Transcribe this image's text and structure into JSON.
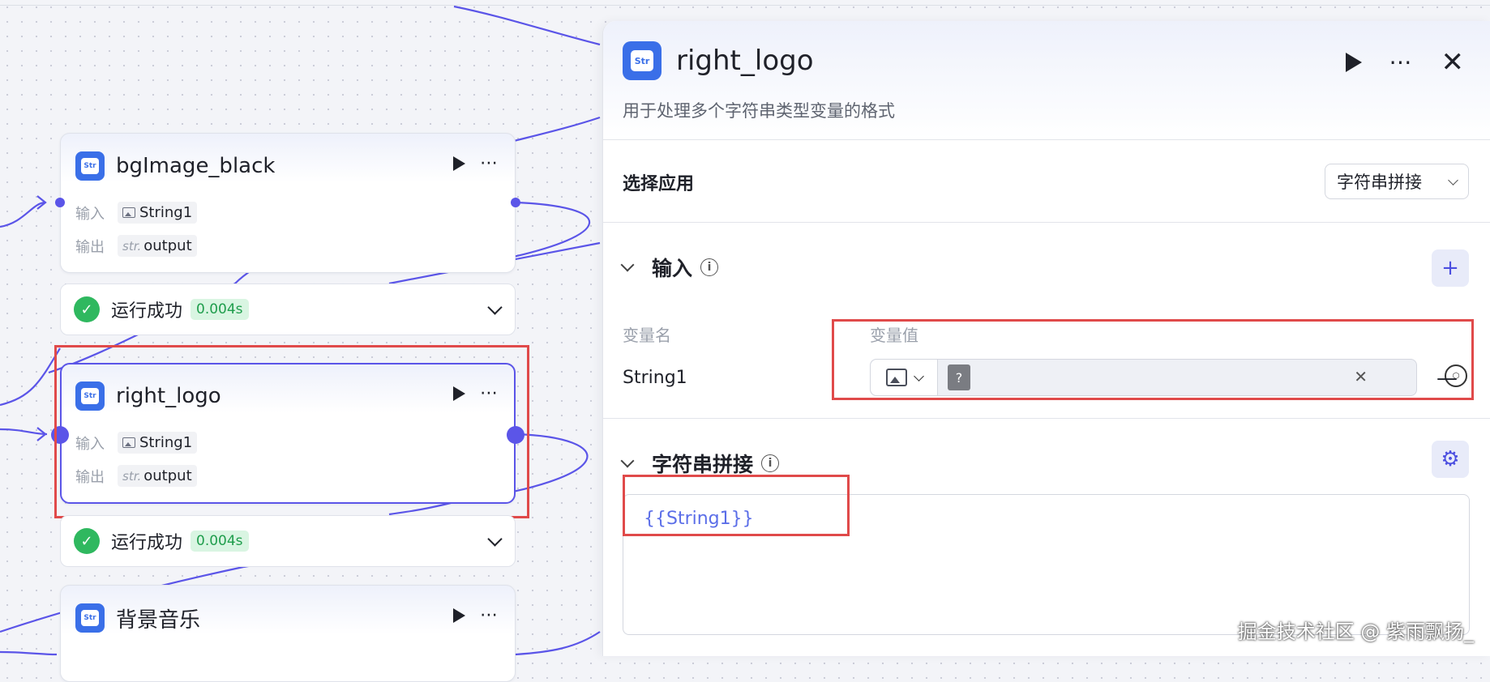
{
  "canvas": {
    "nodes": [
      {
        "title": "bgImage_black",
        "input_label": "输入",
        "input_value": "String1",
        "output_label": "输出",
        "output_type": "str.",
        "output_value": "output"
      },
      {
        "title": "right_logo",
        "input_label": "输入",
        "input_value": "String1",
        "output_label": "输出",
        "output_type": "str.",
        "output_value": "output"
      },
      {
        "title": "背景音乐"
      }
    ],
    "status": [
      {
        "text": "运行成功",
        "time": "0.004s"
      },
      {
        "text": "运行成功",
        "time": "0.004s"
      }
    ]
  },
  "panel": {
    "title": "right_logo",
    "icon_text": "Str",
    "description": "用于处理多个字符串类型变量的格式",
    "select_app_label": "选择应用",
    "select_app_value": "字符串拼接",
    "input_section_title": "输入",
    "col_var_name": "变量名",
    "col_var_value": "变量值",
    "var_name": "String1",
    "var_file_glyph": "?",
    "concat_section_title": "字符串拼接",
    "template_text": "{{String1}}"
  },
  "watermark": "掘金技术社区 @ 紫雨飘扬_",
  "colors": {
    "accent": "#5b55e8",
    "brand_blue": "#3a6fe8",
    "success": "#2fb85f",
    "highlight_red": "#e04a4a"
  }
}
